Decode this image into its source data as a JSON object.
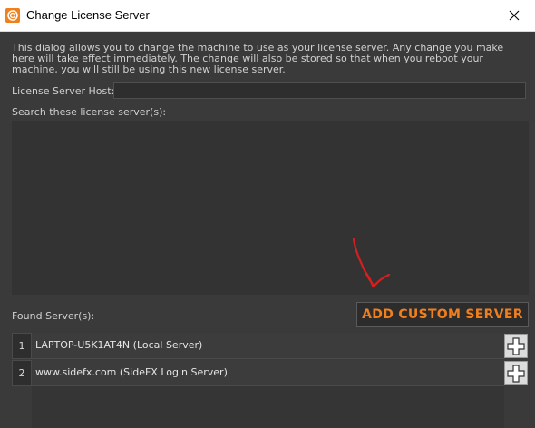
{
  "window": {
    "title": "Change License Server"
  },
  "description": "This dialog allows you to change the machine to use as your license server.  Any change you make here will take effect immediately.  The change will also be stored so that when you reboot your machine, you will still be using this new license server.",
  "host": {
    "label": "License Server Host:",
    "value": "",
    "placeholder": ""
  },
  "search": {
    "label": "Search these license server(s):",
    "items": []
  },
  "found": {
    "label": "Found Server(s):",
    "add_custom_label": "ADD CUSTOM SERVER",
    "servers": [
      {
        "index": "1",
        "name": "LAPTOP-U5K1AT4N (Local Server)"
      },
      {
        "index": "2",
        "name": "www.sidefx.com (SideFX Login Server)"
      }
    ]
  },
  "colors": {
    "accent": "#f07f1e",
    "annotation_arrow": "#d42020",
    "background": "#3a3a3a"
  },
  "icons": {
    "app": "houdini-logo-icon",
    "close": "close-icon",
    "add": "plus-icon",
    "annotation": "red-arrow-annotation"
  }
}
